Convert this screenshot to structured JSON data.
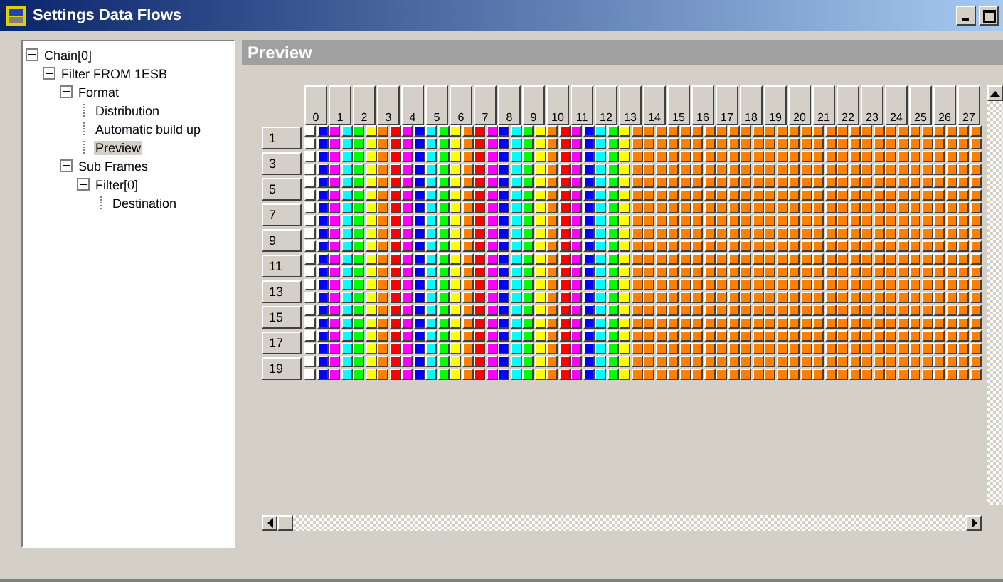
{
  "window": {
    "title": "Settings Data Flows"
  },
  "tree": [
    {
      "label": "Chain[0]",
      "expanded": true,
      "selected": false,
      "children": [
        {
          "label": "Filter FROM 1ESB",
          "expanded": true,
          "selected": false,
          "children": [
            {
              "label": "Format",
              "expanded": true,
              "selected": false,
              "children": [
                {
                  "label": "Distribution",
                  "selected": false
                },
                {
                  "label": "Automatic build up",
                  "selected": false
                },
                {
                  "label": "Preview",
                  "selected": true
                }
              ]
            },
            {
              "label": "Sub Frames",
              "expanded": true,
              "selected": false,
              "children": [
                {
                  "label": "Filter[0]",
                  "expanded": true,
                  "selected": false,
                  "children": [
                    {
                      "label": "Destination",
                      "selected": false
                    }
                  ]
                }
              ]
            }
          ]
        }
      ]
    }
  ],
  "preview": {
    "title": "Preview",
    "rows": [
      "1",
      "3",
      "5",
      "7",
      "9",
      "11",
      "13",
      "15",
      "17",
      "19"
    ],
    "columns": [
      {
        "label": "0",
        "cells": [
          {
            "color": "#ffffff"
          },
          {
            "color": "#0000ff"
          }
        ]
      },
      {
        "label": "1",
        "cells": [
          {
            "color": "#ff00ff"
          },
          {
            "color": "#00ffff"
          }
        ]
      },
      {
        "label": "2",
        "cells": [
          {
            "color": "#00ff00"
          },
          {
            "color": "#ffff00"
          }
        ]
      },
      {
        "label": "3",
        "cells": [
          {
            "color": "#ff8000"
          },
          {
            "color": "#ff0000"
          }
        ]
      },
      {
        "label": "4",
        "cells": [
          {
            "color": "#ff00ff"
          },
          {
            "color": "#0000ff"
          }
        ]
      },
      {
        "label": "5",
        "cells": [
          {
            "color": "#00ffff"
          },
          {
            "color": "#00ff00"
          }
        ]
      },
      {
        "label": "6",
        "cells": [
          {
            "color": "#ffff00"
          },
          {
            "color": "#ff8000"
          }
        ]
      },
      {
        "label": "7",
        "cells": [
          {
            "color": "#ff0000"
          },
          {
            "color": "#ff00ff"
          }
        ]
      },
      {
        "label": "8",
        "cells": [
          {
            "color": "#0000ff"
          },
          {
            "color": "#00ffff"
          }
        ]
      },
      {
        "label": "9",
        "cells": [
          {
            "color": "#00ff00"
          },
          {
            "color": "#ffff00"
          }
        ]
      },
      {
        "label": "10",
        "cells": [
          {
            "color": "#ff8000"
          },
          {
            "color": "#ff0000"
          }
        ]
      },
      {
        "label": "11",
        "cells": [
          {
            "color": "#ff00ff"
          },
          {
            "color": "#0000ff"
          }
        ]
      },
      {
        "label": "12",
        "cells": [
          {
            "color": "#00ffff"
          },
          {
            "color": "#00ff00"
          }
        ]
      },
      {
        "label": "13",
        "cells": [
          {
            "color": "#ffff00"
          },
          {
            "color": "#ff8000"
          }
        ]
      },
      {
        "label": "14",
        "cells": [
          {
            "color": "#ff8000"
          },
          {
            "color": "#ff8000"
          }
        ]
      },
      {
        "label": "15",
        "cells": [
          {
            "color": "#ff8000"
          },
          {
            "color": "#ff8000"
          }
        ]
      },
      {
        "label": "16",
        "cells": [
          {
            "color": "#ff8000"
          },
          {
            "color": "#ff8000"
          }
        ]
      },
      {
        "label": "17",
        "cells": [
          {
            "color": "#ff8000"
          },
          {
            "color": "#ff8000"
          }
        ]
      },
      {
        "label": "18",
        "cells": [
          {
            "color": "#ff8000"
          },
          {
            "color": "#ff8000"
          }
        ]
      },
      {
        "label": "19",
        "cells": [
          {
            "color": "#ff8000"
          },
          {
            "color": "#ff8000"
          }
        ]
      },
      {
        "label": "20",
        "cells": [
          {
            "color": "#ff8000"
          },
          {
            "color": "#ff8000"
          }
        ]
      },
      {
        "label": "21",
        "cells": [
          {
            "color": "#ff8000"
          },
          {
            "color": "#ff8000"
          }
        ]
      },
      {
        "label": "22",
        "cells": [
          {
            "color": "#ff8000"
          },
          {
            "color": "#ff8000"
          }
        ]
      },
      {
        "label": "23",
        "cells": [
          {
            "color": "#ff8000"
          },
          {
            "color": "#ff8000"
          }
        ]
      },
      {
        "label": "24",
        "cells": [
          {
            "color": "#ff8000"
          },
          {
            "color": "#ff8000"
          }
        ]
      },
      {
        "label": "25",
        "cells": [
          {
            "color": "#ff8000"
          },
          {
            "color": "#ff8000"
          }
        ]
      },
      {
        "label": "26",
        "cells": [
          {
            "color": "#ff8000"
          },
          {
            "color": "#ff8000"
          }
        ]
      },
      {
        "label": "27",
        "cells": [
          {
            "color": "#ff8000"
          },
          {
            "color": "#ff8000"
          }
        ]
      }
    ]
  }
}
